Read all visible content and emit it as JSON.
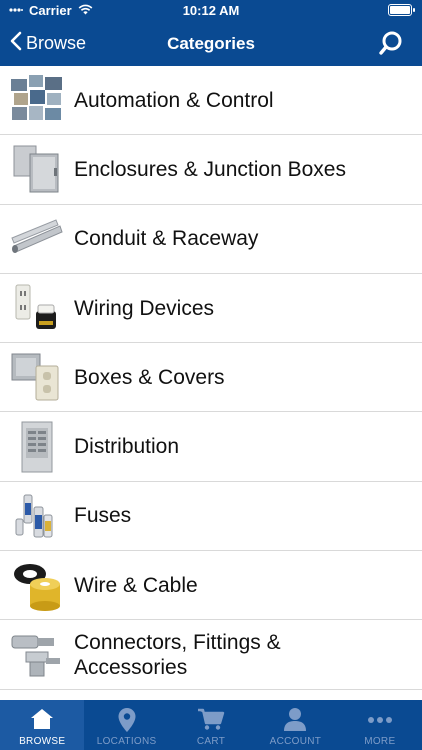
{
  "status_bar": {
    "carrier": "Carrier",
    "time": "10:12 AM"
  },
  "nav": {
    "back_label": "Browse",
    "title": "Categories"
  },
  "categories": [
    {
      "label": "Automation & Control",
      "icon": "automation-thumbnail"
    },
    {
      "label": "Enclosures & Junction Boxes",
      "icon": "enclosure-thumbnail"
    },
    {
      "label": "Conduit & Raceway",
      "icon": "conduit-thumbnail"
    },
    {
      "label": "Wiring Devices",
      "icon": "wiring-device-thumbnail"
    },
    {
      "label": "Boxes & Covers",
      "icon": "box-cover-thumbnail"
    },
    {
      "label": "Distribution",
      "icon": "distribution-panel-thumbnail"
    },
    {
      "label": "Fuses",
      "icon": "fuse-thumbnail"
    },
    {
      "label": "Wire & Cable",
      "icon": "wire-spool-thumbnail"
    },
    {
      "label_line1": "Connectors, Fittings &",
      "label_line2": "Accessories",
      "icon": "connector-thumbnail"
    }
  ],
  "tabbar": {
    "tabs": [
      {
        "label": "BROWSE",
        "icon": "home-icon",
        "active": true
      },
      {
        "label": "LOCATIONS",
        "icon": "location-pin-icon",
        "active": false
      },
      {
        "label": "CART",
        "icon": "cart-icon",
        "active": false
      },
      {
        "label": "ACCOUNT",
        "icon": "person-icon",
        "active": false
      },
      {
        "label": "MORE",
        "icon": "more-dots-icon",
        "active": false
      }
    ]
  },
  "colors": {
    "header_bg": "#0a4a92",
    "active_tab_bg": "#1c5aa3",
    "inactive_tab_text": "#7d9cc8"
  }
}
